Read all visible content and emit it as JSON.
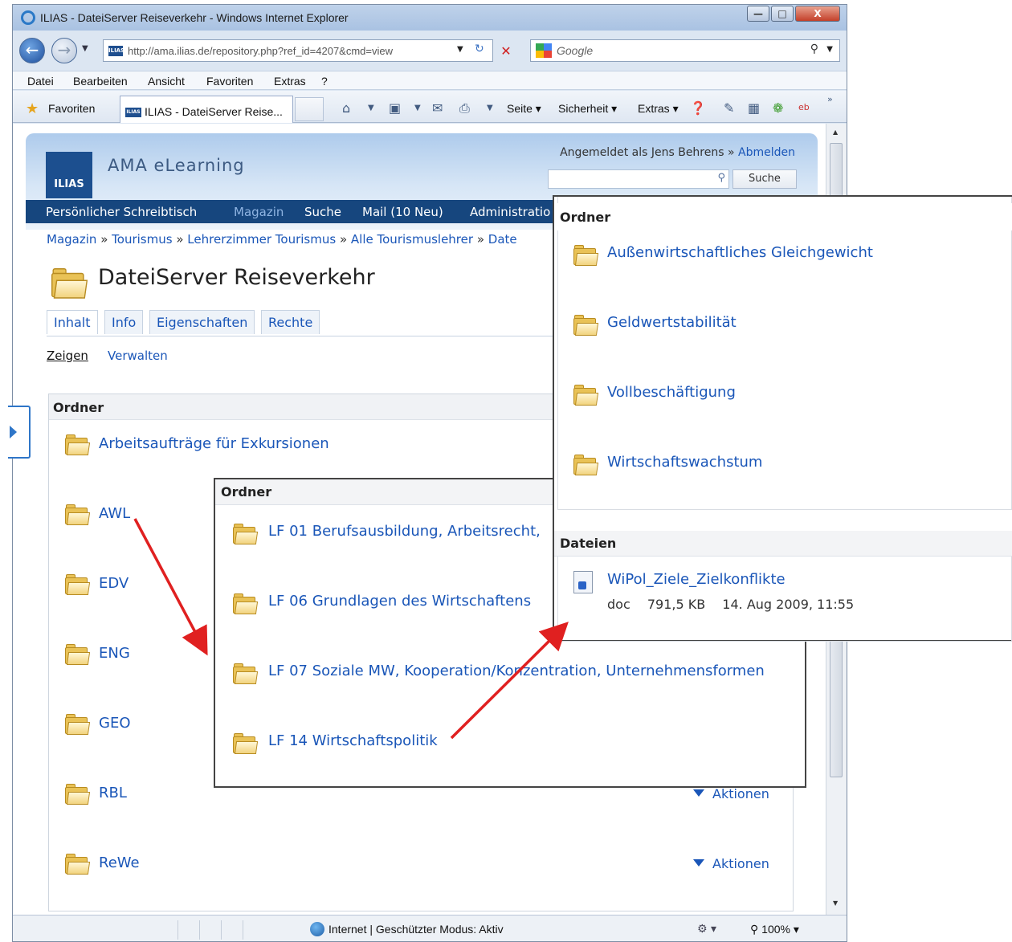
{
  "browser": {
    "window_title": "ILIAS - DateiServer Reiseverkehr - Windows Internet Explorer",
    "window_buttons": {
      "minimize": "—",
      "maximize": "□",
      "close": "X"
    },
    "url": "http://ama.ilias.de/repository.php?ref_id=4207&cmd=view",
    "favicon_label": "ILIAS",
    "search_placeholder": "Google",
    "menu": [
      "Datei",
      "Bearbeiten",
      "Ansicht",
      "Favoriten",
      "Extras",
      "?"
    ],
    "favorites_label": "Favoriten",
    "tab_title": "ILIAS - DateiServer Reise...",
    "commands": {
      "page": "Seite",
      "security": "Sicherheit",
      "extras": "Extras"
    },
    "status": "Internet | Geschützter Modus: Aktiv",
    "zoom": "100%"
  },
  "site": {
    "logo_text": "ILIAS",
    "title": "AMA eLearning",
    "login_text": "Angemeldet als Jens Behrens",
    "login_separator": "»",
    "logout_label": "Abmelden",
    "search_button": "Suche",
    "nav": [
      {
        "label": "Persönlicher Schreibtisch",
        "active": false
      },
      {
        "label": "Magazin",
        "active": true
      },
      {
        "label": "Suche",
        "active": false
      },
      {
        "label": "Mail (10 Neu)",
        "active": false
      },
      {
        "label": "Administratio",
        "active": false
      }
    ],
    "breadcrumb": [
      "Magazin",
      "Tourismus",
      "Lehrerzimmer Tourismus",
      "Alle Tourismuslehrer",
      "Date"
    ],
    "breadcrumb_separator": "»"
  },
  "page": {
    "title": "DateiServer Reiseverkehr",
    "tabs": [
      {
        "label": "Inhalt",
        "active": true
      },
      {
        "label": "Info",
        "active": false
      },
      {
        "label": "Eigenschaften",
        "active": false
      },
      {
        "label": "Rechte",
        "active": false
      }
    ],
    "subtabs": {
      "show": "Zeigen",
      "manage": "Verwalten"
    },
    "block_title": "Ordner",
    "folders": [
      "Arbeitsaufträge für Exkursionen",
      "AWL",
      "EDV",
      "ENG",
      "GEO",
      "RBL",
      "ReWe"
    ],
    "actions_label": "Aktionen"
  },
  "popup_mid": {
    "title": "Ordner",
    "folders": [
      "LF 01 Berufsausbildung, Arbeitsrecht, ",
      "LF 06 Grundlagen des Wirtschaftens",
      "LF 07 Soziale MW, Kooperation/Konzentration, Unternehmensformen",
      "LF 14 Wirtschaftspolitik"
    ]
  },
  "popup_right": {
    "folders_title": "Ordner",
    "folders": [
      "Außenwirtschaftliches Gleichgewicht",
      "Geldwertstabilität",
      "Vollbeschäftigung",
      "Wirtschaftswachstum"
    ],
    "files_title": "Dateien",
    "file": {
      "name": "WiPol_Ziele_Zielkonflikte",
      "type": "doc",
      "size": "791,5 KB",
      "date": "14. Aug 2009, 11:55"
    }
  },
  "colors": {
    "link": "#1a56b8",
    "nav_bg": "#16467e",
    "arrow": "#e02020"
  }
}
